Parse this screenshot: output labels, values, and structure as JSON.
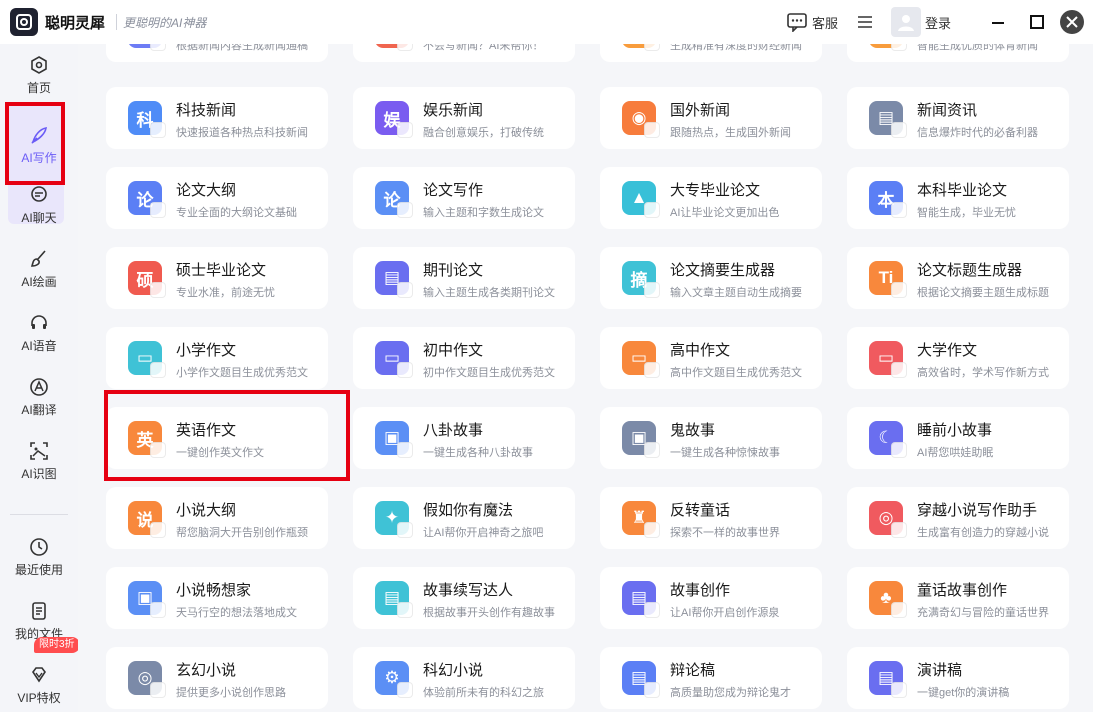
{
  "app": {
    "name": "聪明灵犀",
    "slogan": "更聪明的AI神器",
    "service_label": "客服",
    "login_label": "登录"
  },
  "sidebar": {
    "items": [
      {
        "label": "首页",
        "icon": "home-icon"
      },
      {
        "label": "AI写作",
        "icon": "feather-pen-icon",
        "active": true
      },
      {
        "label": "AI聊天",
        "icon": "chat-bubble-icon"
      },
      {
        "label": "AI绘画",
        "icon": "paint-brush-icon"
      },
      {
        "label": "AI语音",
        "icon": "headset-icon"
      },
      {
        "label": "AI翻译",
        "icon": "translate-icon"
      },
      {
        "label": "AI识图",
        "icon": "image-scan-icon"
      }
    ],
    "bottom": [
      {
        "label": "最近使用",
        "icon": "history-clock-icon"
      },
      {
        "label": "我的文件",
        "icon": "file-icon"
      },
      {
        "label": "VIP特权",
        "icon": "diamond-icon",
        "badge": "限时3折"
      }
    ]
  },
  "colors": {
    "accent": "#6b5cf6",
    "highlight": "#e60012"
  },
  "cards": [
    [
      {
        "title": "",
        "desc": "根据新闻内容生成新闻通稿",
        "color": "#6d7cf5",
        "icon": "news-icon"
      },
      {
        "title": "",
        "desc": "不会写新闻？AI来帮你！",
        "color": "#f0654f",
        "icon": "news-icon"
      },
      {
        "title": "",
        "desc": "生成精准有深度的财经新闻",
        "color": "#f89c3c",
        "icon": "finance-icon"
      },
      {
        "title": "",
        "desc": "智能生成优质的体育新闻",
        "color": "#f89c3c",
        "icon": "sports-icon"
      }
    ],
    [
      {
        "title": "科技新闻",
        "desc": "快速报道各种热点科技新闻",
        "color": "#4f8cf7",
        "glyph": "科",
        "icon": "science-icon"
      },
      {
        "title": "娱乐新闻",
        "desc": "融合创意娱乐，打破传统",
        "color": "#7a5cf0",
        "glyph": "娱",
        "icon": "entertainment-icon"
      },
      {
        "title": "国外新闻",
        "desc": "跟随热点，生成国外新闻",
        "color": "#f77c3c",
        "glyph": "◉",
        "icon": "globe-icon"
      },
      {
        "title": "新闻资讯",
        "desc": "信息爆炸时代的必备利器",
        "color": "#7b8aa8",
        "glyph": "▤",
        "icon": "newspaper-icon"
      }
    ],
    [
      {
        "title": "论文大纲",
        "desc": "专业全面的大纲论文基础",
        "color": "#5b7ff5",
        "glyph": "论",
        "icon": "paper-outline-icon"
      },
      {
        "title": "论文写作",
        "desc": "输入主题和字数生成论文",
        "color": "#5b8ff5",
        "glyph": "论",
        "icon": "paper-write-icon"
      },
      {
        "title": "大专毕业论文",
        "desc": "AI让毕业论文更加出色",
        "color": "#38c0d8",
        "glyph": "▲",
        "icon": "graduation-cap-icon"
      },
      {
        "title": "本科毕业论文",
        "desc": "智能生成，毕业无忧",
        "color": "#5b7ff5",
        "glyph": "本",
        "icon": "bachelor-paper-icon"
      }
    ],
    [
      {
        "title": "硕士毕业论文",
        "desc": "专业水准，前途无忧",
        "color": "#f05a4f",
        "glyph": "硕",
        "icon": "master-paper-icon"
      },
      {
        "title": "期刊论文",
        "desc": "输入主题生成各类期刊论文",
        "color": "#6a6ef0",
        "glyph": "▤",
        "icon": "journal-icon"
      },
      {
        "title": "论文摘要生成器",
        "desc": "输入文章主题自动生成摘要",
        "color": "#3fc2d6",
        "glyph": "摘",
        "icon": "abstract-icon"
      },
      {
        "title": "论文标题生成器",
        "desc": "根据论文摘要主题生成标题",
        "color": "#f8883c",
        "glyph": "Ti",
        "icon": "title-icon"
      }
    ],
    [
      {
        "title": "小学作文",
        "desc": "小学作文题目生成优秀范文",
        "color": "#3fc2d6",
        "glyph": "▭",
        "icon": "primary-essay-icon"
      },
      {
        "title": "初中作文",
        "desc": "初中作文题目生成优秀范文",
        "color": "#6a6ef0",
        "glyph": "▭",
        "icon": "junior-essay-icon"
      },
      {
        "title": "高中作文",
        "desc": "高中作文题目生成优秀范文",
        "color": "#f8883c",
        "glyph": "▭",
        "icon": "senior-essay-icon"
      },
      {
        "title": "大学作文",
        "desc": "高效省时，学术写作新方式",
        "color": "#f05a5f",
        "glyph": "▭",
        "icon": "college-essay-icon"
      }
    ],
    [
      {
        "title": "英语作文",
        "desc": "一键创作英文作文",
        "color": "#f8883c",
        "glyph": "英",
        "icon": "english-essay-icon"
      },
      {
        "title": "八卦故事",
        "desc": "一键生成各种八卦故事",
        "color": "#5b8ff5",
        "glyph": "▣",
        "icon": "gossip-icon"
      },
      {
        "title": "鬼故事",
        "desc": "一键生成各种惊悚故事",
        "color": "#7b8aa8",
        "glyph": "▣",
        "icon": "ghost-story-icon"
      },
      {
        "title": "睡前小故事",
        "desc": "AI帮您哄娃助眠",
        "color": "#6a6ef0",
        "glyph": "☾",
        "icon": "moon-icon"
      }
    ],
    [
      {
        "title": "小说大纲",
        "desc": "帮您脑洞大开告别创作瓶颈",
        "color": "#f8883c",
        "glyph": "说",
        "icon": "novel-outline-icon"
      },
      {
        "title": "假如你有魔法",
        "desc": "让AI帮你开启神奇之旅吧",
        "color": "#3fc2d6",
        "glyph": "✦",
        "icon": "magic-icon"
      },
      {
        "title": "反转童话",
        "desc": "探索不一样的故事世界",
        "color": "#f8883c",
        "glyph": "♜",
        "icon": "castle-icon"
      },
      {
        "title": "穿越小说写作助手",
        "desc": "生成富有创造力的穿越小说",
        "color": "#f05a5f",
        "glyph": "◎",
        "icon": "time-travel-icon"
      }
    ],
    [
      {
        "title": "小说畅想家",
        "desc": "天马行空的想法落地成文",
        "color": "#5b8ff5",
        "glyph": "▣",
        "icon": "idea-icon"
      },
      {
        "title": "故事续写达人",
        "desc": "根据故事开头创作有趣故事",
        "color": "#3fc2d6",
        "glyph": "▤",
        "icon": "continue-story-icon"
      },
      {
        "title": "故事创作",
        "desc": "让AI帮你开启创作源泉",
        "color": "#6a6ef0",
        "glyph": "▤",
        "icon": "story-create-icon"
      },
      {
        "title": "童话故事创作",
        "desc": "充满奇幻与冒险的童话世界",
        "color": "#f8883c",
        "glyph": "♣",
        "icon": "fairy-tale-icon"
      }
    ],
    [
      {
        "title": "玄幻小说",
        "desc": "提供更多小说创作思路",
        "color": "#7b8aa8",
        "glyph": "◎",
        "icon": "fantasy-icon"
      },
      {
        "title": "科幻小说",
        "desc": "体验前所未有的科幻之旅",
        "color": "#5b8ff5",
        "glyph": "⚙",
        "icon": "scifi-icon"
      },
      {
        "title": "辩论稿",
        "desc": "高质量助您成为辩论鬼才",
        "color": "#5b7ff5",
        "glyph": "▤",
        "icon": "debate-icon"
      },
      {
        "title": "演讲稿",
        "desc": "一键get你的演讲稿",
        "color": "#6a6ef0",
        "glyph": "▤",
        "icon": "speech-icon"
      }
    ]
  ]
}
